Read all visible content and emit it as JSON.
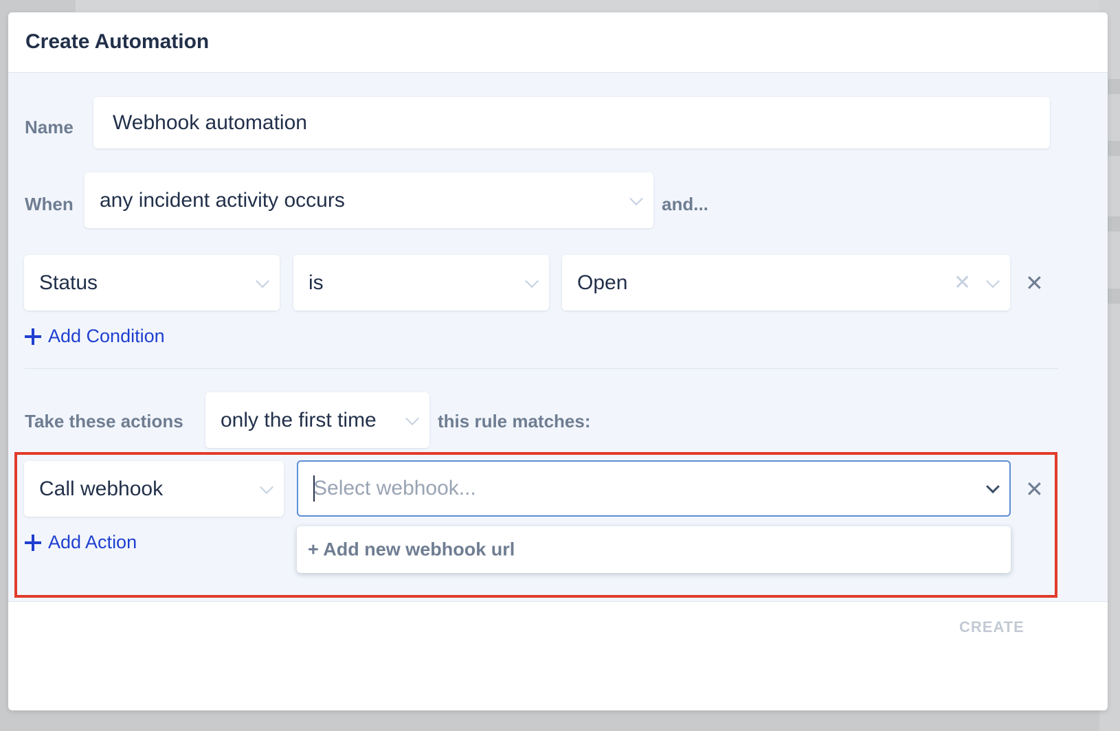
{
  "modal": {
    "title": "Create Automation"
  },
  "form": {
    "name_label": "Name",
    "name_value": "Webhook automation",
    "when_label": "When",
    "when_value": "any incident activity occurs",
    "and_label": "and...",
    "condition": {
      "field": "Status",
      "operator": "is",
      "value": "Open"
    },
    "add_condition_label": "Add Condition",
    "take_actions_label": "Take these actions",
    "frequency_value": "only the first time",
    "rule_matches_label": "this rule matches:",
    "action": {
      "type": "Call webhook",
      "webhook_placeholder": "Select webhook..."
    },
    "dropdown_options": [
      "+ Add new webhook url"
    ],
    "add_action_label": "Add Action"
  },
  "footer": {
    "create_label": "CREATE"
  },
  "colors": {
    "accent_link": "#1f3fcf",
    "highlight_border": "#e23b2a",
    "focus_border": "#5b8ed6",
    "title_text": "#22304a",
    "label_text": "#6f7d92"
  },
  "icons": [
    "chevron-down-icon",
    "clear-icon",
    "remove-icon",
    "plus-icon"
  ]
}
